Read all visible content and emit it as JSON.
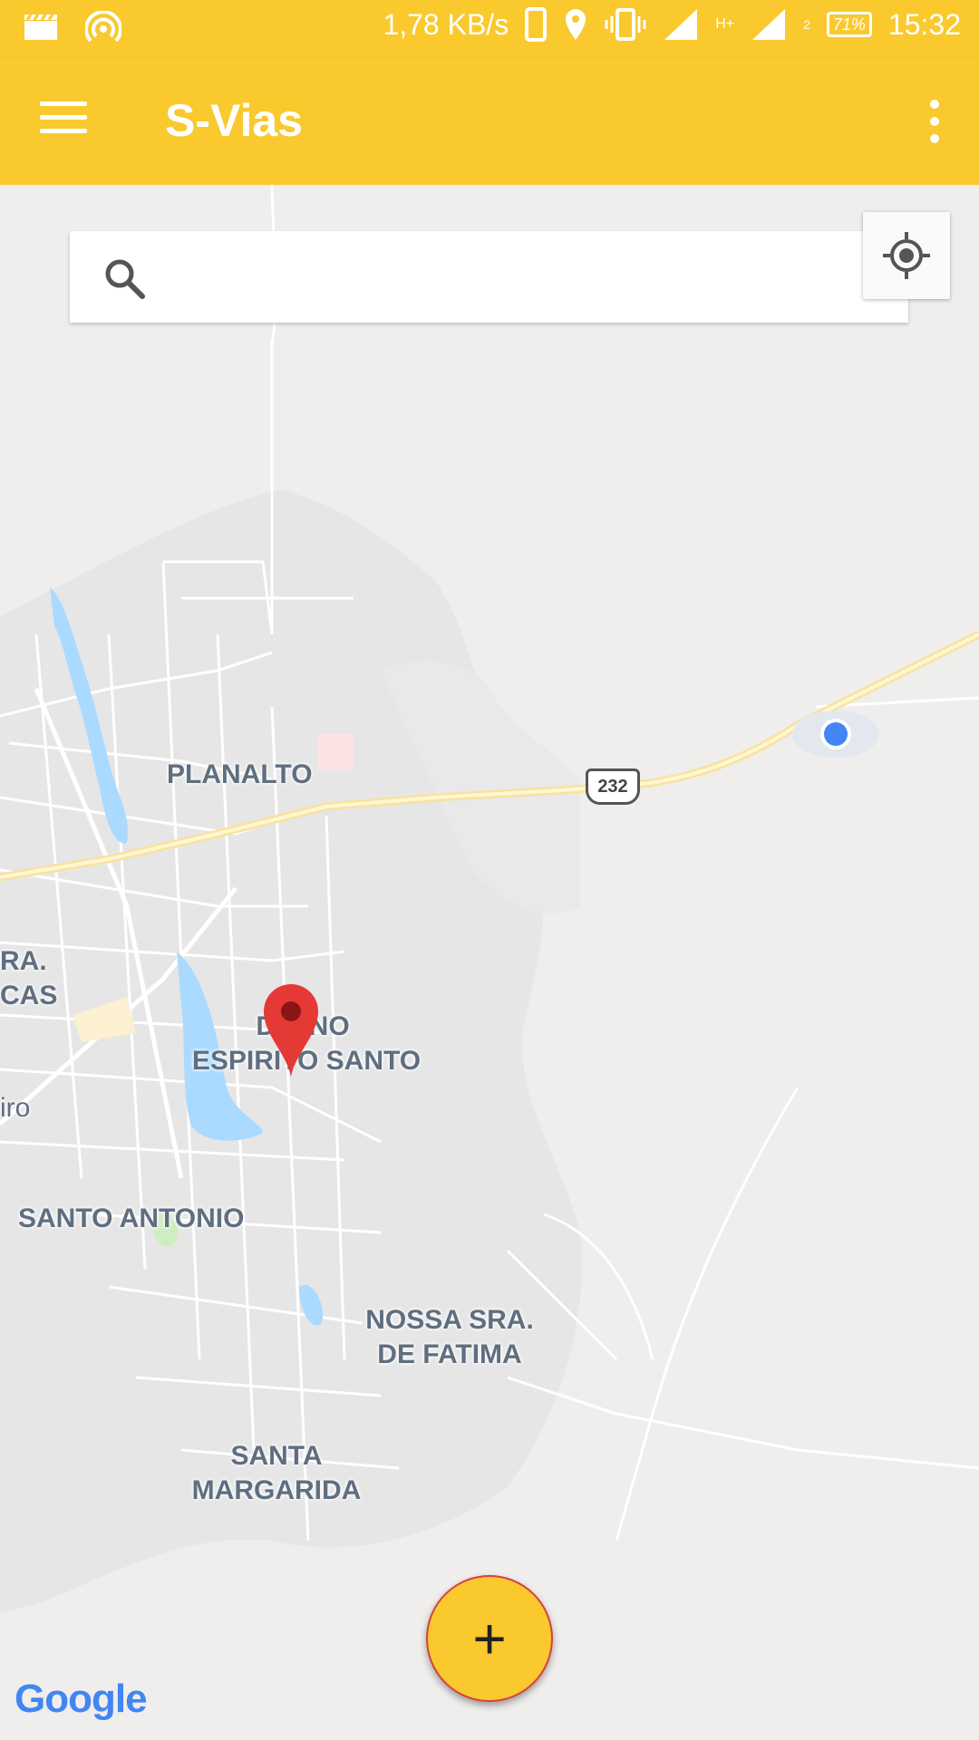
{
  "status_bar": {
    "net_speed": "1,78 KB/s",
    "battery": "71%",
    "time": "15:32",
    "sim2_label": "2",
    "network_type": "H+",
    "icons": [
      "clapper-icon",
      "hotspot-icon",
      "phone-icon",
      "location-icon",
      "vibrate-icon",
      "signal-icon",
      "signal-icon",
      "battery-icon"
    ]
  },
  "app_bar": {
    "title": "S-Vias",
    "menu_icon": "menu-icon",
    "overflow_icon": "more-vert-icon"
  },
  "search": {
    "placeholder": "",
    "icon": "search-icon"
  },
  "map": {
    "road_shield": "232",
    "labels": {
      "planalto": "PLANALTO",
      "divino_line1": "DIVINO",
      "divino_line2": "ESPIRITO SANTO",
      "santo_antonio": "SANTO ANTONIO",
      "nossa_line1": "NOSSA SRA.",
      "nossa_line2": "DE FATIMA",
      "santa_line1": "SANTA",
      "santa_line2": "MARGARIDA",
      "edge_ra": "RA.",
      "edge_cas": "CAS",
      "edge_iro": "iro"
    },
    "attribution": "Google"
  },
  "fab": {
    "label": "+",
    "icon": "add-icon"
  },
  "colors": {
    "accent": "#f9c92e",
    "map_bg": "#ededed",
    "water": "#aadaff",
    "pin": "#e53935",
    "location_dot": "#4285f4"
  }
}
